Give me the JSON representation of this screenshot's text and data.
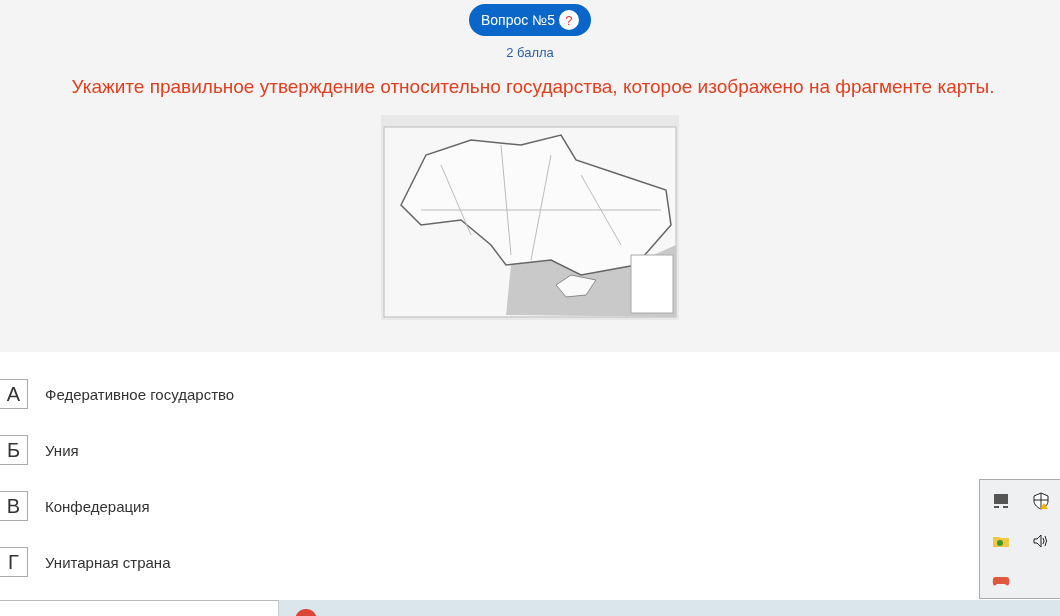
{
  "header": {
    "label": "Вопрос №5",
    "help": "?",
    "points": "2 балла"
  },
  "question": "Укажите правильное утверждение относительно государства, которое изображено на фрагменте карты.",
  "answers": [
    {
      "letter": "А",
      "text": "Федеративное государство"
    },
    {
      "letter": "Б",
      "text": "Уния"
    },
    {
      "letter": "В",
      "text": "Конфедерация"
    },
    {
      "letter": "Г",
      "text": "Унитарная страна"
    }
  ]
}
